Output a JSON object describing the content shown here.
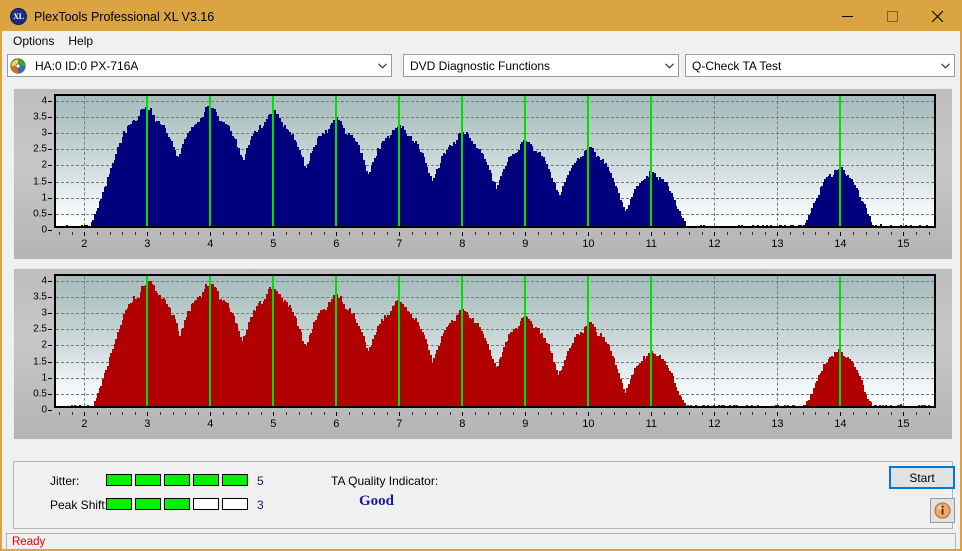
{
  "window": {
    "title": "PlexTools Professional XL V3.16",
    "icon": "xl-app-icon",
    "icon_text": "XL",
    "accent_titlebar": "#d9a441",
    "controls": [
      {
        "name": "minimize-button",
        "glyph": "minimize-icon"
      },
      {
        "name": "maximize-button",
        "glyph": "maximize-icon"
      },
      {
        "name": "close-button",
        "glyph": "close-icon"
      }
    ]
  },
  "menu": {
    "items": [
      {
        "label": "Options"
      },
      {
        "label": "Help"
      }
    ]
  },
  "toolbar": {
    "drive_select": {
      "value": "HA:0 ID:0  PX-716A",
      "icon": "disc-icon"
    },
    "function_select": {
      "value": "DVD Diagnostic Functions"
    },
    "test_select": {
      "value": "Q-Check TA Test"
    }
  },
  "results": {
    "jitter_label": "Jitter:",
    "jitter_value": "5",
    "jitter_filled": 5,
    "jitter_total": 5,
    "peak_shift_label": "Peak Shift:",
    "peak_shift_value": "3",
    "peak_shift_filled": 3,
    "peak_shift_total": 5,
    "ta_quality_label": "TA Quality Indicator:",
    "ta_quality_value": "Good",
    "ta_quality_color": "#1a1aa0",
    "start_label": "Start",
    "info_label": "i",
    "meter_on_color": "#00f000"
  },
  "statusbar": {
    "text": "Ready",
    "color": "#e00000"
  },
  "chart_data": [
    {
      "type": "bar",
      "name": "ta-test-chart-jitter",
      "title": "",
      "xlabel": "",
      "ylabel": "",
      "series_color": "#2222dd",
      "xlim": [
        1.55,
        15.55
      ],
      "ylim": [
        0,
        4.15
      ],
      "xticks": [
        2,
        3,
        4,
        5,
        6,
        7,
        8,
        9,
        10,
        11,
        12,
        13,
        14,
        15
      ],
      "yticks": [
        0,
        0.5,
        1,
        1.5,
        2,
        2.5,
        3,
        3.5,
        4
      ],
      "ytick_labels": [
        "0",
        "0.5",
        "1",
        "1.5",
        "2",
        "2.5",
        "3",
        "3.5",
        "4"
      ],
      "grid": true,
      "markers": [
        3,
        4,
        5,
        6,
        7,
        8,
        9,
        10,
        11,
        14
      ],
      "marker_color": "#00e000",
      "group_peaks": [
        3.68,
        3.7,
        3.53,
        3.3,
        3.12,
        2.9,
        2.65,
        2.4,
        1.65,
        1.8
      ],
      "group_centers": [
        3,
        4,
        5,
        6,
        7,
        8,
        9,
        10,
        11,
        14
      ],
      "bar_width": 0.018,
      "bar_step": 0.026,
      "envelope": {
        "humps": [
          {
            "center": 2.98,
            "peak": 3.68,
            "half_width": 0.5,
            "shoulder": 0.42
          },
          {
            "center": 4.0,
            "peak": 3.7,
            "half_width": 0.5,
            "shoulder": 0.42
          },
          {
            "center": 5.0,
            "peak": 3.53,
            "half_width": 0.48,
            "shoulder": 0.4
          },
          {
            "center": 6.0,
            "peak": 3.3,
            "half_width": 0.47,
            "shoulder": 0.38
          },
          {
            "center": 7.0,
            "peak": 3.12,
            "half_width": 0.46,
            "shoulder": 0.37
          },
          {
            "center": 8.02,
            "peak": 2.9,
            "half_width": 0.44,
            "shoulder": 0.35
          },
          {
            "center": 9.02,
            "peak": 2.65,
            "half_width": 0.42,
            "shoulder": 0.33
          },
          {
            "center": 10.02,
            "peak": 2.4,
            "half_width": 0.4,
            "shoulder": 0.31
          },
          {
            "center": 11.02,
            "peak": 1.65,
            "half_width": 0.33,
            "shoulder": 0.25
          },
          {
            "center": 13.98,
            "peak": 1.8,
            "half_width": 0.33,
            "shoulder": 0.25
          }
        ],
        "noise_amp": 0.14,
        "gap_noise": 0.05
      }
    },
    {
      "type": "bar",
      "name": "ta-test-chart-peak-shift",
      "title": "",
      "xlabel": "",
      "ylabel": "",
      "series_color": "#fa0a0a",
      "xlim": [
        1.55,
        15.55
      ],
      "ylim": [
        0,
        4.15
      ],
      "xticks": [
        2,
        3,
        4,
        5,
        6,
        7,
        8,
        9,
        10,
        11,
        12,
        13,
        14,
        15
      ],
      "yticks": [
        0,
        0.5,
        1,
        1.5,
        2,
        2.5,
        3,
        3.5,
        4
      ],
      "ytick_labels": [
        "0",
        "0.5",
        "1",
        "1.5",
        "2",
        "2.5",
        "3",
        "3.5",
        "4"
      ],
      "grid": true,
      "markers": [
        3,
        4,
        5,
        6,
        7,
        8,
        9,
        10,
        11,
        14
      ],
      "marker_color": "#00e000",
      "group_peaks": [
        3.85,
        3.8,
        3.67,
        3.45,
        3.25,
        3.0,
        2.75,
        2.55,
        1.7,
        1.72
      ],
      "group_centers": [
        3,
        4,
        5,
        6,
        7,
        8,
        9,
        10,
        11,
        14
      ],
      "bar_width": 0.018,
      "bar_step": 0.026,
      "envelope": {
        "humps": [
          {
            "center": 3.02,
            "peak": 3.85,
            "half_width": 0.5,
            "shoulder": 0.42
          },
          {
            "center": 4.0,
            "peak": 3.8,
            "half_width": 0.48,
            "shoulder": 0.4
          },
          {
            "center": 5.0,
            "peak": 3.67,
            "half_width": 0.47,
            "shoulder": 0.39
          },
          {
            "center": 6.0,
            "peak": 3.45,
            "half_width": 0.46,
            "shoulder": 0.38
          },
          {
            "center": 7.0,
            "peak": 3.25,
            "half_width": 0.45,
            "shoulder": 0.37
          },
          {
            "center": 8.02,
            "peak": 3.0,
            "half_width": 0.43,
            "shoulder": 0.35
          },
          {
            "center": 9.02,
            "peak": 2.75,
            "half_width": 0.41,
            "shoulder": 0.33
          },
          {
            "center": 10.02,
            "peak": 2.55,
            "half_width": 0.4,
            "shoulder": 0.31
          },
          {
            "center": 11.02,
            "peak": 1.7,
            "half_width": 0.32,
            "shoulder": 0.24
          },
          {
            "center": 13.98,
            "peak": 1.72,
            "half_width": 0.32,
            "shoulder": 0.24
          }
        ],
        "noise_amp": 0.15,
        "gap_noise": 0.05
      }
    }
  ]
}
